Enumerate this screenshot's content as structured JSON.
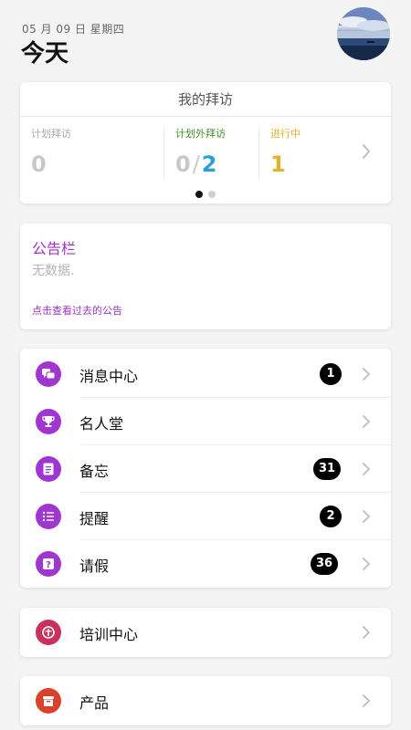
{
  "header": {
    "date": "05 月 09 日 星期四",
    "title": "今天"
  },
  "visits": {
    "title": "我的拜访",
    "planned_label": "计划拜访",
    "planned_value": "0",
    "unplanned_label": "计划外拜访",
    "unplanned_done": "0",
    "unplanned_sep": "/",
    "unplanned_total": "2",
    "in_progress_label": "进行中",
    "in_progress_value": "1",
    "page_indicator": {
      "current": 1,
      "total": 2
    }
  },
  "notice": {
    "title": "公告栏",
    "empty_text": "无数据.",
    "past_link": "点击查看过去的公告"
  },
  "menu": {
    "items": [
      {
        "label": "消息中心",
        "badge": "1",
        "icon": "message-icon"
      },
      {
        "label": "名人堂",
        "badge": "",
        "icon": "trophy-icon"
      },
      {
        "label": "备忘",
        "badge": "31",
        "icon": "memo-icon"
      },
      {
        "label": "提醒",
        "badge": "2",
        "icon": "reminder-icon"
      },
      {
        "label": "请假",
        "badge": "36",
        "icon": "leave-icon"
      }
    ]
  },
  "training": {
    "label": "培训中心",
    "icon": "training-icon"
  },
  "product": {
    "label": "产品",
    "icon": "product-icon"
  },
  "colors": {
    "accent_purple": "#a033c7",
    "unplanned_green": "#3e8e2d",
    "in_progress_yellow": "#e2b22a",
    "total_blue": "#2aa0d6",
    "training_red": "#c8315a",
    "product_red": "#d9412a"
  }
}
